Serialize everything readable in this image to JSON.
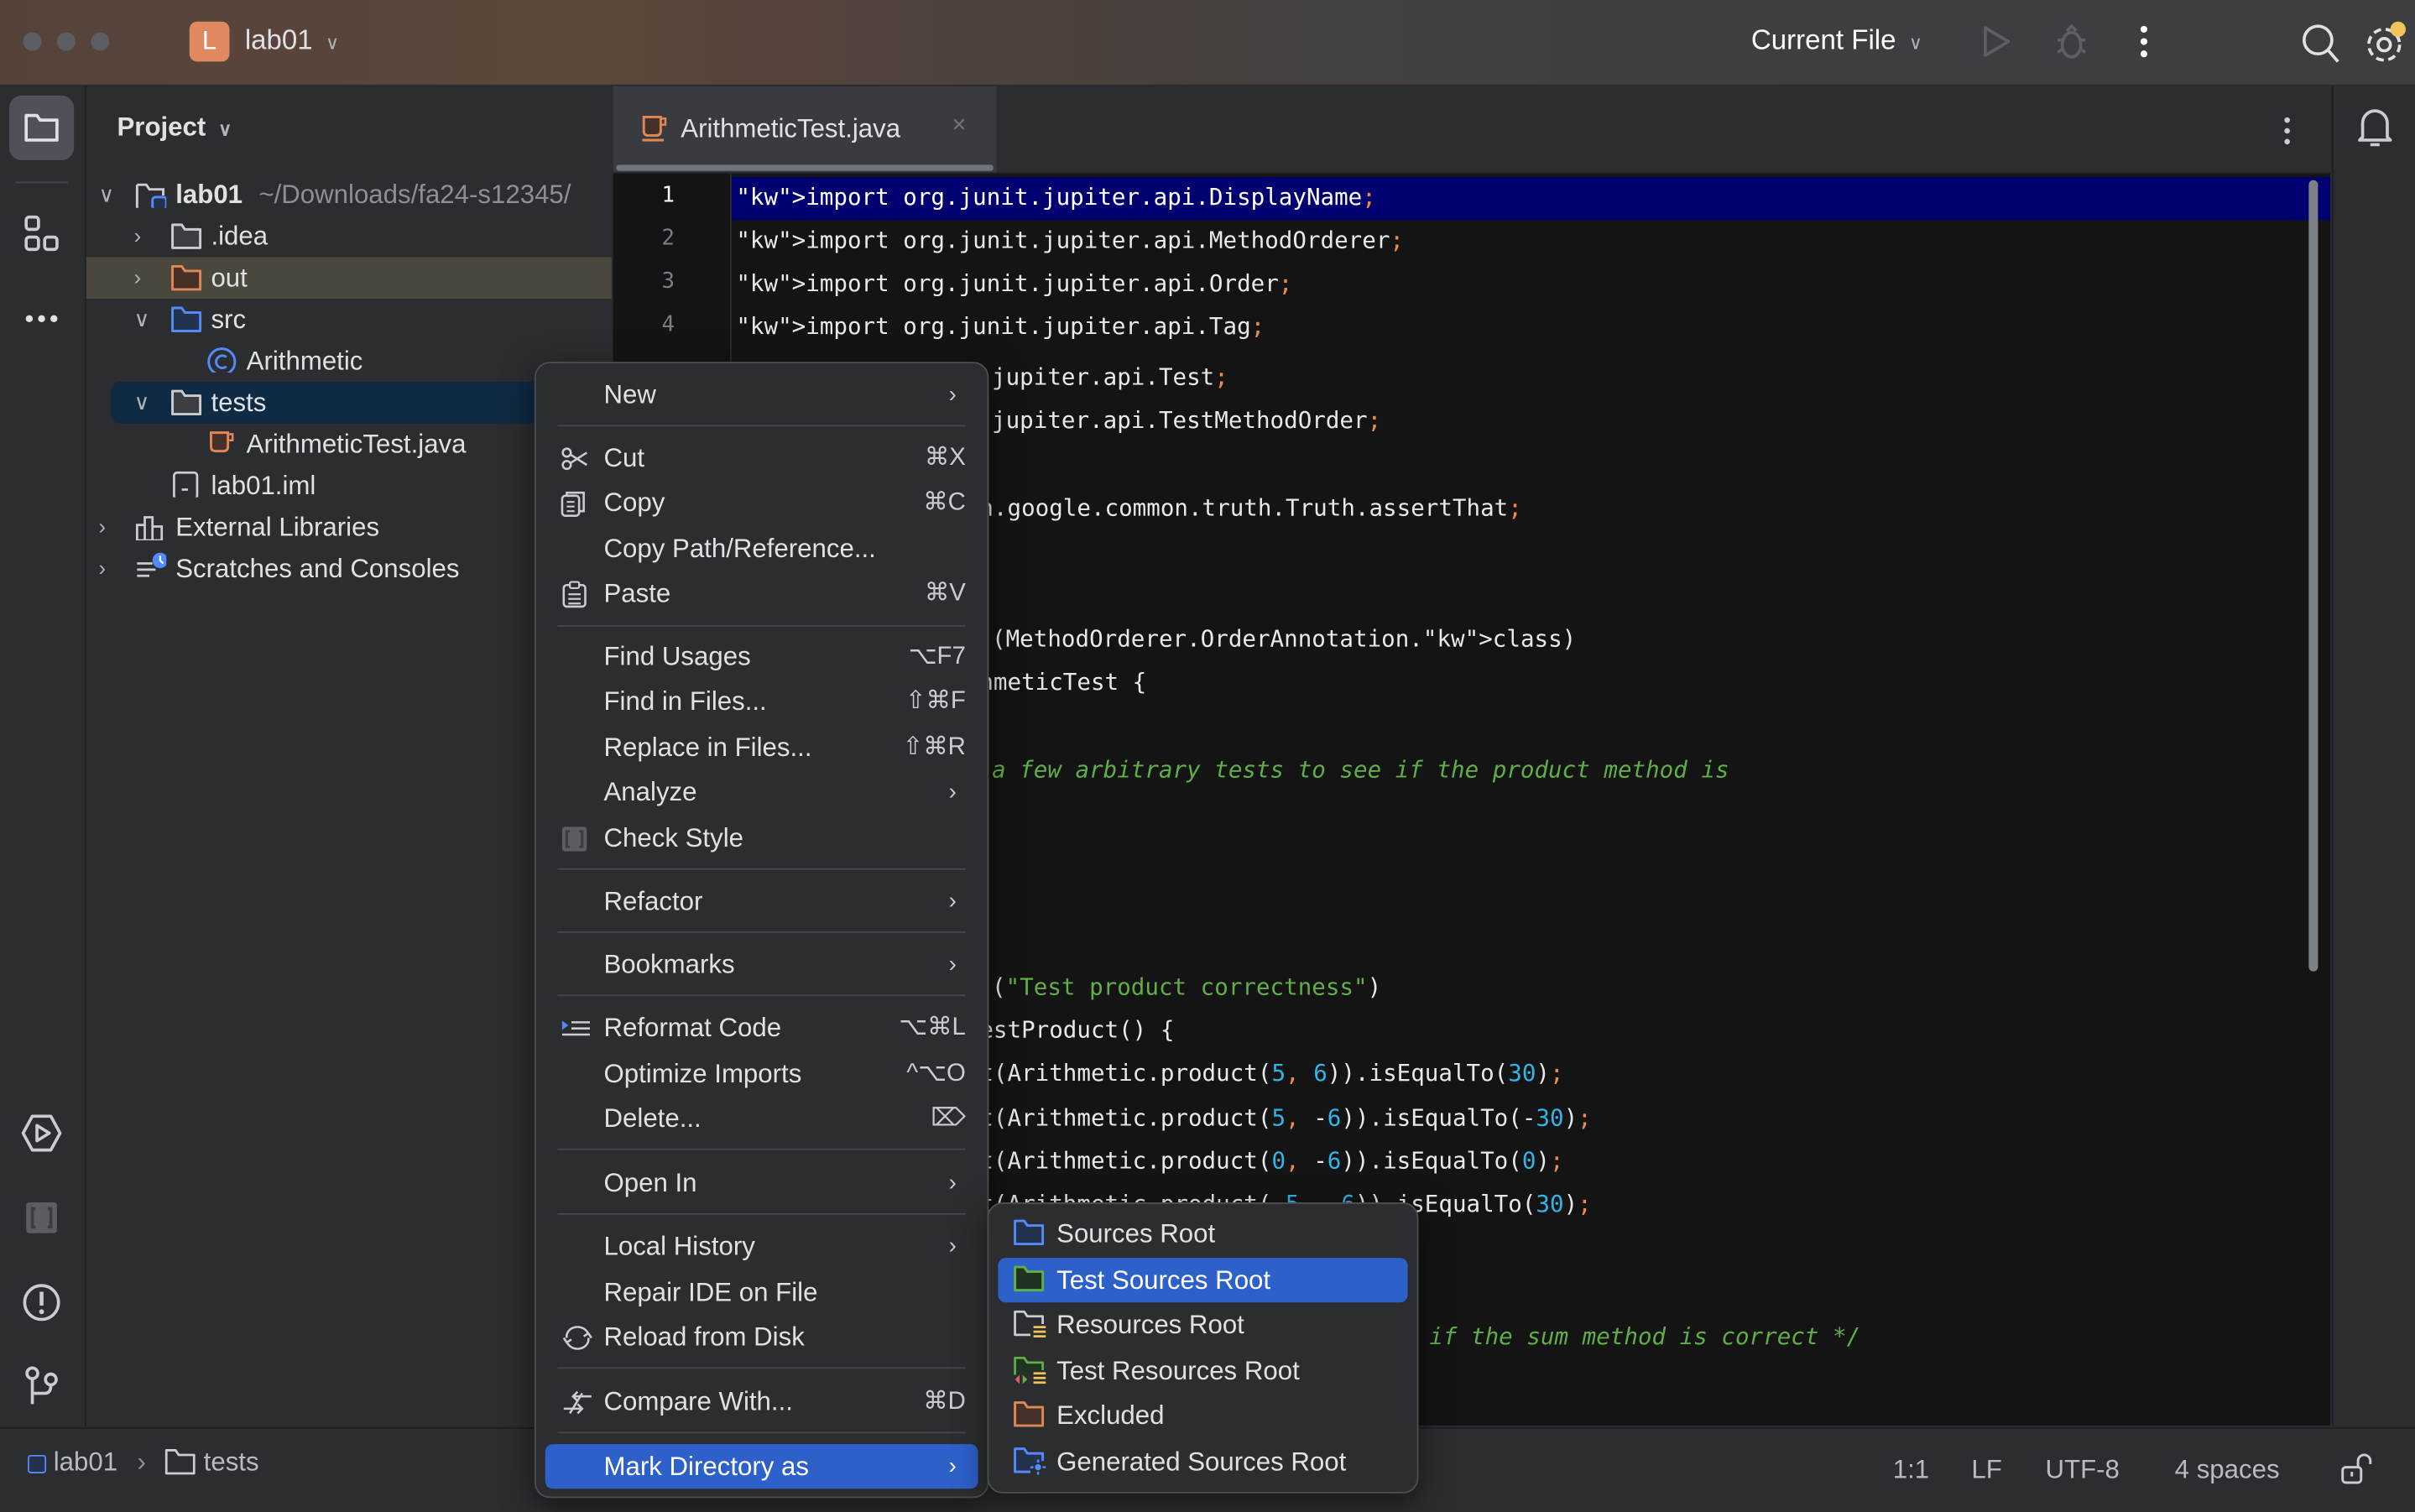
{
  "window": {
    "project_badge": "L",
    "project_name": "lab01",
    "run_config": "Current File"
  },
  "project_panel": {
    "title": "Project",
    "tree": [
      {
        "label": "lab01",
        "suffix": "~/Downloads/fa24-s12345/",
        "expanded": true,
        "icon": "module-folder-icon"
      },
      {
        "label": ".idea",
        "expanded": false,
        "icon": "folder-icon"
      },
      {
        "label": "out",
        "expanded": false,
        "icon": "excluded-folder-icon",
        "highlighted": true
      },
      {
        "label": "src",
        "expanded": true,
        "icon": "source-folder-icon"
      },
      {
        "label": "Arithmetic",
        "icon": "java-class-icon"
      },
      {
        "label": "tests",
        "expanded": true,
        "icon": "folder-icon",
        "selected": true
      },
      {
        "label": "ArithmeticTest.java",
        "icon": "java-file-icon"
      },
      {
        "label": "lab01.iml",
        "icon": "iml-file-icon"
      },
      {
        "label": "External Libraries",
        "expanded": false,
        "icon": "library-icon"
      },
      {
        "label": "Scratches and Consoles",
        "expanded": false,
        "icon": "scratches-icon"
      }
    ]
  },
  "editor": {
    "tab_label": "ArithmeticTest.java",
    "lines": [
      {
        "n": "1",
        "text": "import org.junit.jupiter.api.DisplayName;"
      },
      {
        "n": "2",
        "text": "import org.junit.jupiter.api.MethodOrderer;"
      },
      {
        "n": "3",
        "text": "import org.junit.jupiter.api.Order;"
      },
      {
        "n": "4",
        "text": "import org.junit.jupiter.api.Tag;"
      }
    ],
    "visible_fragments": [
      "jupiter.api.Test;",
      "jupiter.api.TestMethodOrder;",
      "n.google.common.truth.Truth.assertThat;",
      "(MethodOrderer.OrderAnnotation.class)",
      "hmeticTest {",
      "a few arbitrary tests to see if the product method is",
      "(\"Test product correctness\")",
      "estProduct() {",
      "t(Arithmetic.product(5, 6)).isEqualTo(30);",
      "t(Arithmetic.product(5, -6)).isEqualTo(-30);",
      "t(Arithmetic.product(0, -6)).isEqualTo(0);",
      "t(Arithmetic.product(-5, -6)).isEqualTo(30);",
      "if the sum method is correct */"
    ]
  },
  "context_menu": {
    "items": [
      {
        "label": "New",
        "submenu": true
      },
      {
        "label": "Cut",
        "shortcut": "⌘X",
        "icon": "scissors-icon"
      },
      {
        "label": "Copy",
        "shortcut": "⌘C",
        "icon": "copy-icon"
      },
      {
        "label": "Copy Path/Reference..."
      },
      {
        "label": "Paste",
        "shortcut": "⌘V",
        "icon": "paste-icon"
      },
      {
        "label": "Find Usages",
        "shortcut": "⌥F7"
      },
      {
        "label": "Find in Files...",
        "shortcut": "⇧⌘F"
      },
      {
        "label": "Replace in Files...",
        "shortcut": "⇧⌘R"
      },
      {
        "label": "Analyze",
        "submenu": true
      },
      {
        "label": "Check Style",
        "icon": "checkstyle-icon"
      },
      {
        "label": "Refactor",
        "submenu": true
      },
      {
        "label": "Bookmarks",
        "submenu": true
      },
      {
        "label": "Reformat Code",
        "shortcut": "⌥⌘L",
        "icon": "reformat-icon"
      },
      {
        "label": "Optimize Imports",
        "shortcut": "^⌥O"
      },
      {
        "label": "Delete...",
        "shortcut": "⌦"
      },
      {
        "label": "Open In",
        "submenu": true
      },
      {
        "label": "Local History",
        "submenu": true
      },
      {
        "label": "Repair IDE on File"
      },
      {
        "label": "Reload from Disk",
        "icon": "reload-icon"
      },
      {
        "label": "Compare With...",
        "shortcut": "⌘D",
        "icon": "compare-icon"
      },
      {
        "label": "Mark Directory as",
        "submenu": true,
        "selected": true
      }
    ]
  },
  "submenu": {
    "items": [
      {
        "label": "Sources Root",
        "icon": "sources-root-icon"
      },
      {
        "label": "Test Sources Root",
        "icon": "test-sources-root-icon",
        "selected": true
      },
      {
        "label": "Resources Root",
        "icon": "resources-root-icon"
      },
      {
        "label": "Test Resources Root",
        "icon": "test-resources-root-icon"
      },
      {
        "label": "Excluded",
        "icon": "excluded-icon"
      },
      {
        "label": "Generated Sources Root",
        "icon": "generated-sources-root-icon"
      }
    ]
  },
  "statusbar": {
    "breadcrumb": [
      "lab01",
      "tests"
    ],
    "position": "1:1",
    "line_ending": "LF",
    "encoding": "UTF-8",
    "indent": "4 spaces"
  },
  "colors": {
    "accent": "#2e60c9",
    "line_highlight": "#010070",
    "keyword": "#ef8a4a",
    "number": "#33b3e6",
    "comment": "#5fae47"
  }
}
